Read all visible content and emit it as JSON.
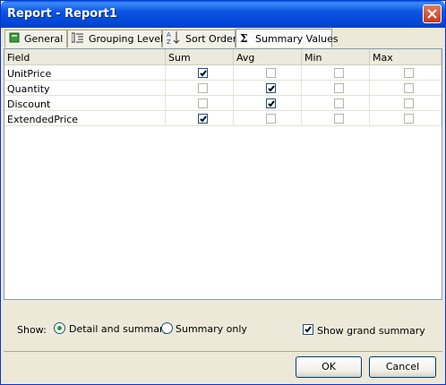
{
  "window": {
    "title": "Report - Report1"
  },
  "tabs": [
    {
      "label": "General",
      "icon": "general-icon"
    },
    {
      "label": "Grouping Levels",
      "icon": "grouping-levels-icon"
    },
    {
      "label": "Sort Order",
      "icon": "sort-az-icon"
    },
    {
      "label": "Summary Values",
      "icon": "sigma-icon",
      "active": true
    }
  ],
  "grid": {
    "columns": [
      "Field",
      "Sum",
      "Avg",
      "Min",
      "Max"
    ],
    "rows": [
      {
        "field": "UnitPrice",
        "sum": true,
        "avg": false,
        "min": false,
        "max": false
      },
      {
        "field": "Quantity",
        "sum": false,
        "avg": true,
        "min": false,
        "max": false
      },
      {
        "field": "Discount",
        "sum": false,
        "avg": true,
        "min": false,
        "max": false
      },
      {
        "field": "ExtendedPrice",
        "sum": true,
        "avg": false,
        "min": false,
        "max": false
      }
    ]
  },
  "show": {
    "label": "Show:",
    "options": [
      {
        "label": "Detail and summary",
        "selected": true
      },
      {
        "label": "Summary only",
        "selected": false
      }
    ],
    "grand_summary": {
      "label": "Show grand summary",
      "checked": true
    }
  },
  "buttons": {
    "ok": "OK",
    "cancel": "Cancel"
  },
  "colors": {
    "titlebar": "#0046d8",
    "window_bg": "#ece9d8",
    "check": "#21a121"
  }
}
